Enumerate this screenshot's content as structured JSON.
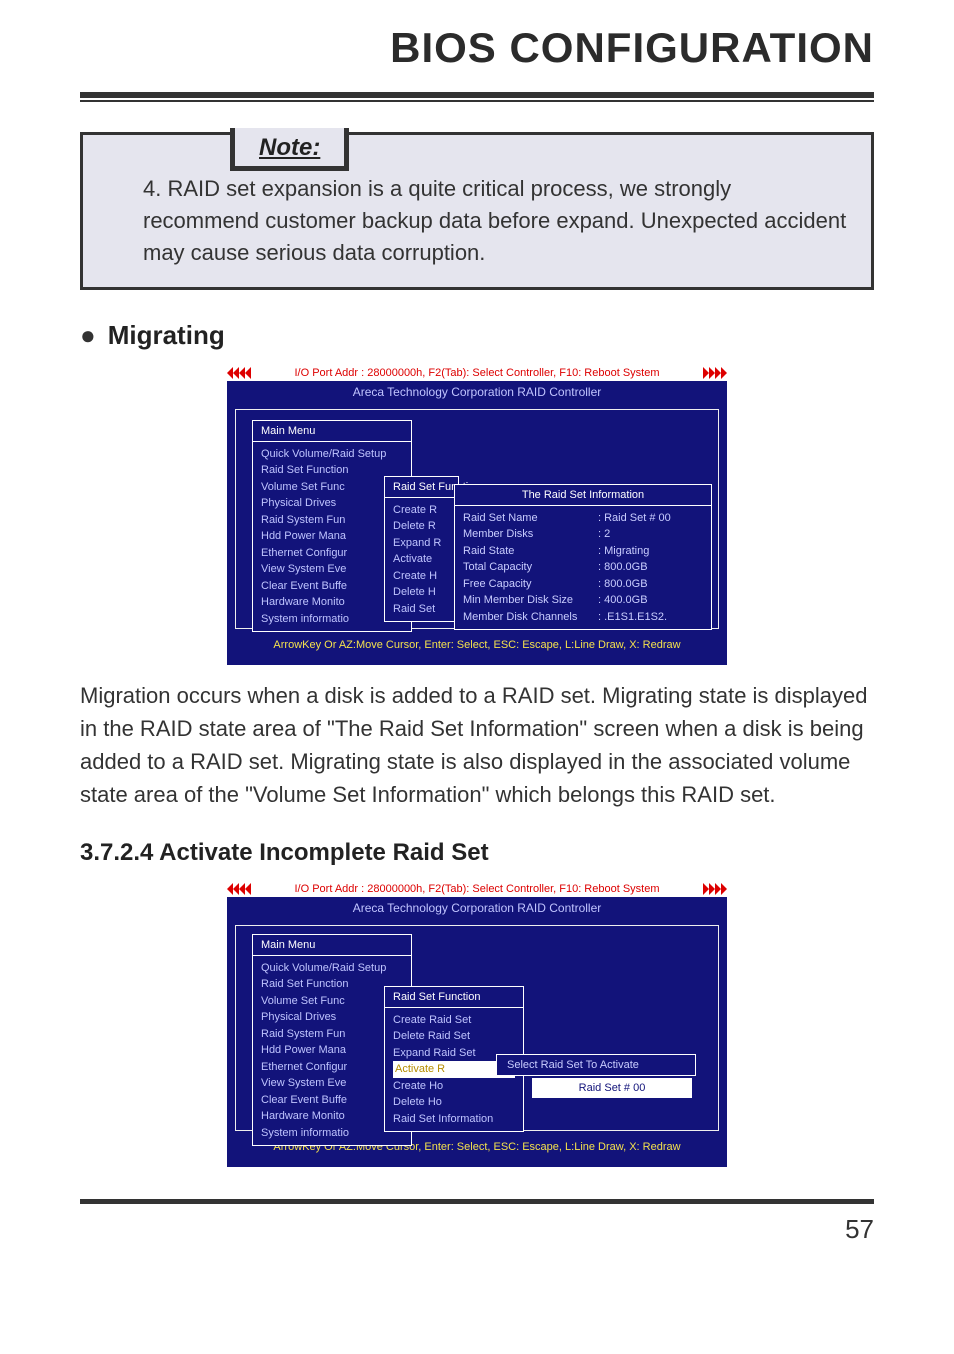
{
  "header": {
    "title": "BIOS CONFIGURATION"
  },
  "note": {
    "tab": "Note:",
    "body": "4. RAID set expansion is a quite critical process, we strongly recommend customer backup data before expand. Unexpected accident may cause serious data corruption."
  },
  "section_migrating": {
    "heading": "Migrating",
    "paragraph": "Migration occurs when a disk is added to a RAID set. Migrating state is displayed in the RAID state area of \"The Raid Set Information\" screen when a disk is being added to a RAID set. Migrating state is also displayed in the associated volume state area of the \"Volume Set Information\" which belongs this RAID set."
  },
  "section_activate": {
    "heading": "3.7.2.4 Activate Incomplete Raid Set"
  },
  "bios_common": {
    "topbar": "I/O Port Addr : 28000000h, F2(Tab): Select Controller, F10: Reboot System",
    "title": "Areca Technology Corporation RAID Controller",
    "footer": "ArrowKey Or AZ:Move Cursor, Enter: Select, ESC: Escape, L:Line Draw, X: Redraw",
    "main_menu": {
      "title": "Main Menu",
      "items": [
        "Quick Volume/Raid Setup",
        "Raid Set Function",
        "Volume Set Func",
        "Physical Drives",
        "Raid System Fun",
        "Hdd Power Mana",
        "Ethernet Configur",
        "View System Eve",
        "Clear Event Buffe",
        "Hardware Monito",
        "System informatio"
      ]
    },
    "raid_func_short": {
      "title": "Raid Set Function",
      "items": [
        "Create R",
        "Delete R",
        "Expand R",
        "Activate",
        "Create H",
        "Delete H",
        "Raid Set"
      ]
    },
    "raid_func_full": {
      "title": "Raid Set Function",
      "items": [
        "Create Raid Set",
        "Delete Raid Set",
        "Expand Raid Set",
        "Activate R",
        "Create Ho",
        "Delete Ho",
        "Raid Set Information"
      ]
    }
  },
  "bios1_info": {
    "title": "The Raid Set Information",
    "rows": [
      {
        "k": "Raid Set Name",
        "v": ":  Raid Set   #  00"
      },
      {
        "k": "Member Disks",
        "v": ":  2"
      },
      {
        "k": "Raid State",
        "v": ":  Migrating"
      },
      {
        "k": "Total Capacity",
        "v": ":  800.0GB"
      },
      {
        "k": "Free Capacity",
        "v": ": 800.0GB"
      },
      {
        "k": "Min Member Disk Size",
        "v": ":  400.0GB"
      },
      {
        "k": "Member Disk Channels",
        "v": ":  .E1S1.E1S2."
      }
    ]
  },
  "bios2_select": {
    "label": "Select Raid Set To Activate",
    "item": "Raid Set    #    00"
  },
  "page_number": "57"
}
